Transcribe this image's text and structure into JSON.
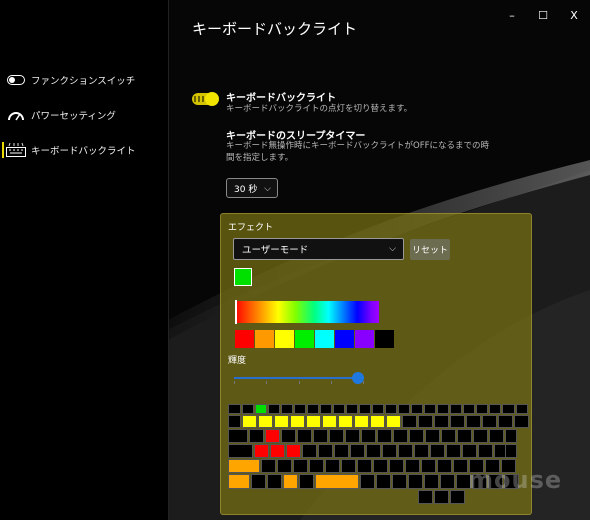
{
  "window": {
    "title": "キーボードバックライト",
    "minimize_label": "–",
    "maximize_label": "☐",
    "close_label": "X"
  },
  "sidebar": {
    "items": [
      {
        "label": "ファンクションスイッチ",
        "icon": "toggle-icon"
      },
      {
        "label": "パワーセッティング",
        "icon": "gauge-icon"
      },
      {
        "label": "キーボードバックライト",
        "icon": "keyboard-icon",
        "active": true
      }
    ]
  },
  "backlight": {
    "title": "キーボードバックライト",
    "desc": "キーボードバックライトの点灯を切り替えます。",
    "enabled": true
  },
  "sleep_timer": {
    "title": "キーボードのスリープタイマー",
    "desc_line1": "キーボード無操作時にキーボードバックライトがOFFになるまでの時",
    "desc_line2": "間を指定します。",
    "value": "30 秒"
  },
  "effect": {
    "label": "エフェクト",
    "mode": "ユーザーモード",
    "reset_label": "リセット",
    "current_color": "#00e000",
    "brightness_label": "輝度",
    "brightness": 0.95,
    "swatches": [
      "#ff0000",
      "#ff9900",
      "#ffff00",
      "#00ee00",
      "#00ffff",
      "#0000ff",
      "#8800ff",
      "#000000"
    ]
  },
  "colors": {
    "accent": "#e9d900",
    "key_yellow": "#ffff00",
    "key_red": "#ff0000",
    "key_orange": "#ffa500",
    "key_green": "#00dd00"
  },
  "watermark": "mouse"
}
